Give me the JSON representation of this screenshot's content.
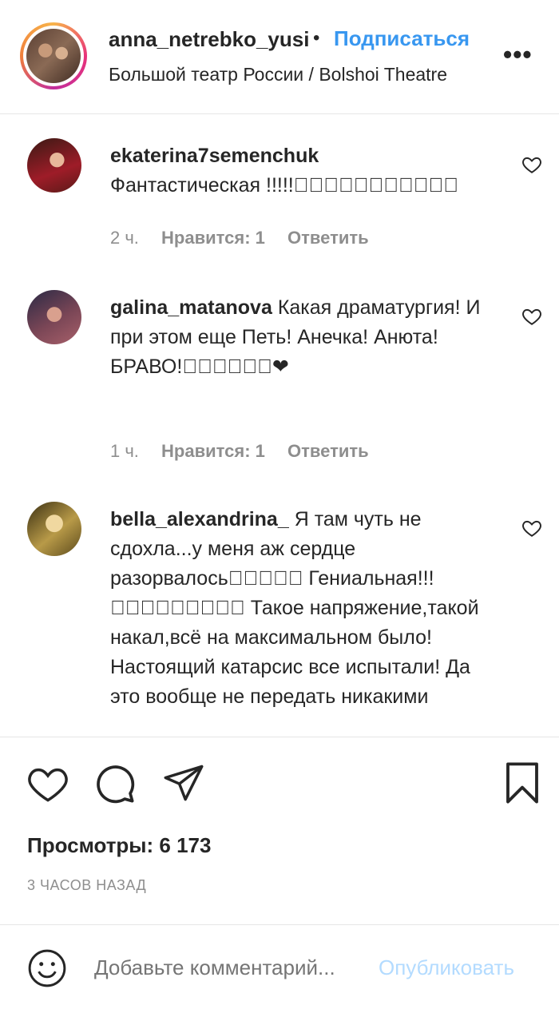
{
  "header": {
    "username": "anna_netrebko_yusifeyeva",
    "separator": "•",
    "follow_label": "Подписаться",
    "location": "Большой театр России / Bolshoi Theatre",
    "more_glyph": "•••"
  },
  "comments": [
    {
      "username": "ekaterina7semenchuk",
      "text": "Фантастическая !!!!!􏿾􏿾􏿾􏿾􏿾􏿾􏿾􏿾􏿾􏿾􏿾",
      "time": "2 ч.",
      "likes": "Нравится: 1",
      "reply": "Ответить",
      "avatar_colors": [
        "#7a1620",
        "#c4495a"
      ]
    },
    {
      "username": "galina_matanova",
      "text": "Какая драматургия! И при этом еще Петь! Анечка! Анюта! БРАВО!􏿾􏿾􏿾􏿾􏿾􏿾❤",
      "time": "1 ч.",
      "likes": "Нравится: 1",
      "reply": "Ответить",
      "avatar_colors": [
        "#3a3550",
        "#b46a72"
      ]
    },
    {
      "username": "bella_alexandrina_",
      "text": "Я там чуть не сдохла...у меня аж сердце разорвалось􏿾􏿾􏿾􏿾􏿾 Гениальная!!!􏿾􏿾􏿾􏿾􏿾􏿾􏿾􏿾􏿾 Такое напряжение,такой накал,всё на максимальном было!Настоящий катарсис все испытали! Да это вообще не передать никакими",
      "avatar_colors": [
        "#d9c27a",
        "#6b5a2c"
      ]
    }
  ],
  "stats": {
    "views": "Просмотры: 6 173",
    "time_ago": "3 ЧАСОВ НАЗАД"
  },
  "compose": {
    "placeholder": "Добавьте комментарий...",
    "publish_label": "Опубликовать"
  },
  "icons": {
    "like": "heart-icon",
    "comment": "comment-icon",
    "share": "share-icon",
    "save": "bookmark-icon",
    "emoji": "emoji-icon"
  }
}
